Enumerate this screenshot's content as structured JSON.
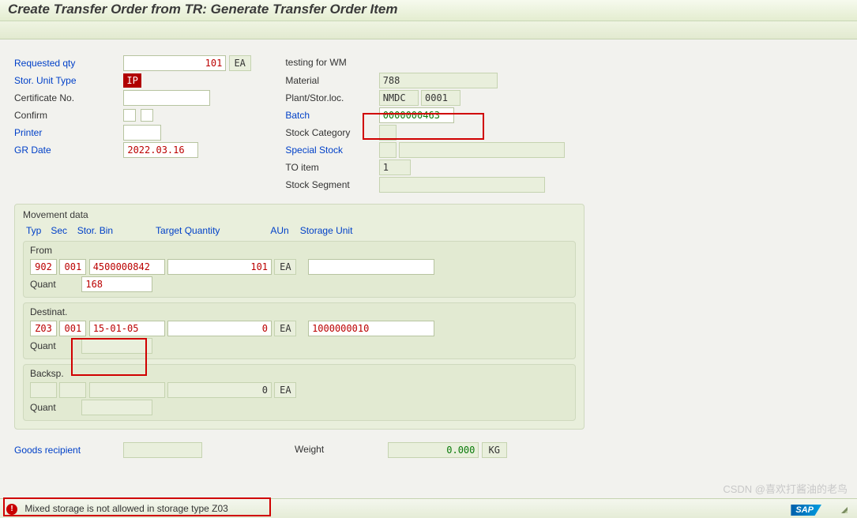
{
  "header": {
    "title": "Create Transfer Order from TR: Generate Transfer Order Item"
  },
  "left": {
    "requested_qty_label": "Requested qty",
    "requested_qty_value": "101",
    "requested_qty_unit": "EA",
    "stor_unit_type_label": "Stor. Unit Type",
    "stor_unit_type_value": "IP",
    "certificate_no_label": "Certificate No.",
    "certificate_no_value": "",
    "confirm_label": "Confirm",
    "printer_label": "Printer",
    "printer_value": "",
    "gr_date_label": "GR Date",
    "gr_date_value": "2022.03.16"
  },
  "right": {
    "description": "testing for WM",
    "material_label": "Material",
    "material_value": "788",
    "plant_label": "Plant/Stor.loc.",
    "plant_value": "NMDC",
    "sloc_value": "0001",
    "batch_label": "Batch",
    "batch_value": "0000000463",
    "stock_cat_label": "Stock Category",
    "stock_cat_value": "",
    "special_stock_label": "Special Stock",
    "special_stock_value": "",
    "to_item_label": "TO item",
    "to_item_value": "1",
    "stock_segment_label": "Stock Segment",
    "stock_segment_value": ""
  },
  "movement": {
    "group_title": "Movement data",
    "hdr_typ": "Typ",
    "hdr_sec": "Sec",
    "hdr_bin": "Stor. Bin",
    "hdr_target": "Target Quantity",
    "hdr_aun": "AUn",
    "hdr_su": "Storage Unit",
    "from": {
      "title": "From",
      "typ": "902",
      "sec": "001",
      "bin": "4500000842",
      "qty": "101",
      "aun": "EA",
      "su": "",
      "quant_label": "Quant",
      "quant": "168"
    },
    "dest": {
      "title": "Destinat.",
      "typ": "Z03",
      "sec": "001",
      "bin": "15-01-05",
      "qty": "0",
      "aun": "EA",
      "su": "1000000010",
      "quant_label": "Quant",
      "quant": ""
    },
    "back": {
      "title": "Backsp.",
      "typ": "",
      "sec": "",
      "bin": "",
      "qty": "0",
      "aun": "EA",
      "su": "",
      "quant_label": "Quant",
      "quant": ""
    }
  },
  "footer": {
    "goods_recipient_label": "Goods recipient",
    "goods_recipient_value": "",
    "weight_label": "Weight",
    "weight_value": "0.000",
    "weight_unit": "KG"
  },
  "status": {
    "message": "Mixed storage is not allowed in storage type Z03"
  },
  "watermark": "CSDN @喜欢打酱油的老鸟",
  "sap": "SAP"
}
